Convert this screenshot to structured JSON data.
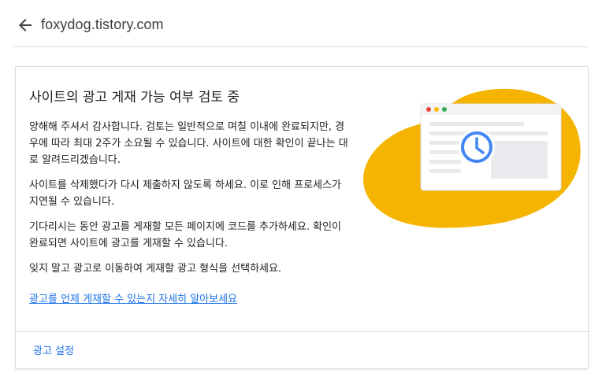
{
  "header": {
    "back_icon": "arrow-back-icon",
    "site_name": "foxydog.tistory.com"
  },
  "card": {
    "title": "사이트의 광고 게재 가능 여부 검토 중",
    "paragraphs": [
      "양해해 주셔서 감사합니다. 검토는 일반적으로 며칠 이내에 완료되지만, 경우에 따라 최대 2주가 소요될 수 있습니다. 사이트에 대한 확인이 끝나는 대로 알려드리겠습니다.",
      "사이트를 삭제했다가 다시 제출하지 않도록 하세요. 이로 인해 프로세스가 지연될 수 있습니다.",
      "기다리시는 동안 광고를 게재할 모든 페이지에 코드를 추가하세요. 확인이 완료되면 사이트에 광고를 게재할 수 있습니다.",
      "잊지 말고 광고로 이동하여 게재할 광고 형식을 선택하세요."
    ],
    "learn_more_link": "광고를 언제 게재할 수 있는지 자세히 알아보세요",
    "footer_link": "광고 설정"
  },
  "illustration": {
    "icon": "browser-clock-illustration",
    "blob_color": "#F4B400",
    "dot_colors": [
      "#EA4335",
      "#FBBC04",
      "#34A853"
    ],
    "clock_color": "#4285F4"
  }
}
